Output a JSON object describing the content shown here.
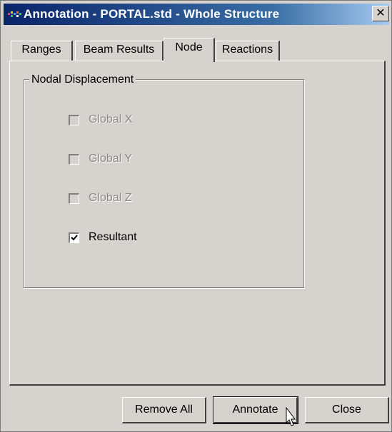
{
  "window": {
    "title": "Annotation - PORTAL.std - Whole Structure",
    "close_symbol": "✕",
    "icon": "app-icon"
  },
  "tabs": [
    {
      "label": "Ranges",
      "active": false
    },
    {
      "label": "Beam Results",
      "active": false
    },
    {
      "label": "Node",
      "active": true
    },
    {
      "label": "Reactions",
      "active": false
    }
  ],
  "group": {
    "label": "Nodal Displacement"
  },
  "checkboxes": [
    {
      "label": "Global X",
      "checked": false,
      "enabled": false
    },
    {
      "label": "Global Y",
      "checked": false,
      "enabled": false
    },
    {
      "label": "Global Z",
      "checked": false,
      "enabled": false
    },
    {
      "label": "Resultant",
      "checked": true,
      "enabled": true
    }
  ],
  "buttons": {
    "remove_all": "Remove All",
    "annotate": "Annotate",
    "close": "Close"
  },
  "colors": {
    "face": "#d6d3ce",
    "title_start": "#0a246a",
    "title_end": "#a6caf0",
    "disabled_text": "#8c8a86"
  }
}
